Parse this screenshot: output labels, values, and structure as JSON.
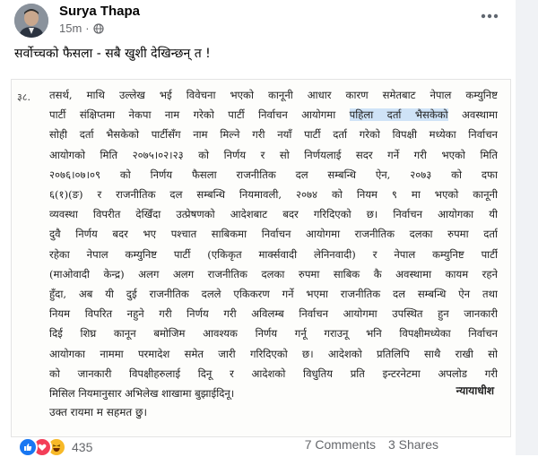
{
  "post": {
    "author": "Surya Thapa",
    "time": "15m",
    "separator": "·",
    "caption": "सर्वोच्चको फैसला - सबै खुशी देखिन्छन् त !"
  },
  "document": {
    "paragraph_number": "३८.",
    "lines": [
      "तसर्थ, माथि उल्लेख भई विवेचना भएको कानूनी आधार कारण समेतबाट नेपाल कम्युनिष्ट",
      "पार्टी संक्षिप्तमा नेकपा नाम गरेको पार्टी निर्वाचन आयोगमा ",
      "सोही दर्ता भैसकेको पार्टीसँग नाम मिल्ने गरी नयाँ पार्टी दर्ता गरेको विपक्षी मध्येका निर्वाचन",
      "आयोगको मिति २०७५।०२।२३ को निर्णय र सो निर्णयलाई सदर गर्ने गरी भएको मिति",
      "२०७६।०७।०९ को निर्णय फैसला राजनीतिक दल सम्बन्धि ऐन, २०७३ को दफा",
      "६(१)(ङ) र राजनीतिक दल सम्बन्धि नियमावली, २०७४ को नियम ९ मा भएको कानूनी",
      "व्यवस्था विपरीत देखिँदा उत्प्रेषणको आदेशबाट बदर गरिदिएको छ। निर्वाचन आयोगका यी",
      "दुवै निर्णय बदर भए पश्चात साबिकमा निर्वाचन आयोगमा राजनीतिक दलका रुपमा दर्ता",
      "रहेका नेपाल कम्युनिष्ट पार्टी (एकिकृत मार्क्सवादी लेनिनवादी) र नेपाल कम्युनिष्ट पार्टी",
      "(माओवादी केन्द्र) अलग अलग राजनीतिक दलका रुपमा साबिक कै अवस्थामा कायम रहने",
      "हुँदा, अब यी दुई राजनीतिक दलले एकिकरण गर्ने भएमा राजनीतिक दल सम्बन्धि ऐन तथा",
      "नियम विपरित नहुने गरी निर्णय गरी अविलम्ब निर्वाचन आयोगमा उपस्थित हुन जानकारी",
      "दिई शिघ्र कानून बमोजिम आवश्यक निर्णय गर्नू गराउनू भनि विपक्षीमध्येका निर्वाचन",
      "आयोगका नाममा परमादेश समेत जारी गरिदिएको छ। आदेशको प्रतिलिपि साथै राखी सो",
      "को जानकारी विपक्षीहरुलाई दिनू र आदेशको विधुतिय प्रति इन्टरनेटमा अपलोड गरी",
      "मिसिल नियमानुसार अभिलेख शाखामा बुझाईदिनू।"
    ],
    "highlighted_text": "पहिला दर्ता भैसकेको",
    "highlight_after": " अवस्थामा",
    "signature": "न्यायाधीश",
    "agreement": "उक्त रायमा म सहमत छु।"
  },
  "footer": {
    "reaction_count": "435",
    "comments": "7 Comments",
    "shares": "3 Shares"
  },
  "colors": {
    "like": "#1877f2",
    "love": "#f33e58",
    "haha": "#f7b928",
    "highlight": "#cfe3f7"
  },
  "icons": {
    "globe": "globe-icon",
    "more": "more-options-icon",
    "like": "like-reaction-icon",
    "love": "love-reaction-icon",
    "haha": "haha-reaction-icon"
  }
}
